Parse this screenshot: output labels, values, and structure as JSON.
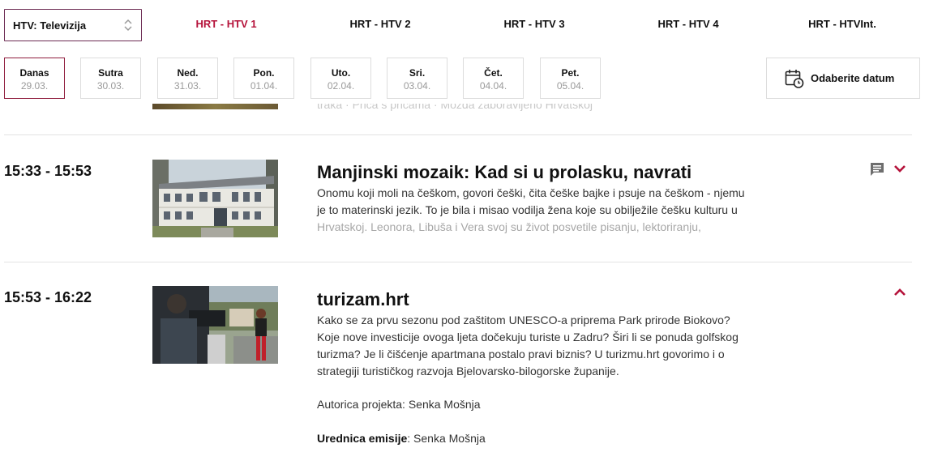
{
  "header": {
    "platform_select": "HTV: Televizija",
    "channels": [
      "HRT - HTV 1",
      "HRT - HTV 2",
      "HRT - HTV 3",
      "HRT - HTV 4",
      "HRT - HTVInt."
    ],
    "active_channel": "HRT - HTV 1",
    "accent_color": "#b5123a"
  },
  "days": [
    {
      "name": "Danas",
      "date": "29.03."
    },
    {
      "name": "Sutra",
      "date": "30.03."
    },
    {
      "name": "Ned.",
      "date": "31.03."
    },
    {
      "name": "Pon.",
      "date": "01.04."
    },
    {
      "name": "Uto.",
      "date": "02.04."
    },
    {
      "name": "Sri.",
      "date": "03.04."
    },
    {
      "name": "Čet.",
      "date": "04.04."
    },
    {
      "name": "Pet.",
      "date": "05.04."
    }
  ],
  "pick_date": {
    "label": "Odaberite datum",
    "icon": "calendar-clock-icon"
  },
  "previous_item_text": "traka · Priča s pričama · Možda zaboravljeno Hrvatskoj",
  "programs": [
    {
      "time": "15:33 - 15:53",
      "title": "Manjinski mozaik: Kad si u prolasku, navrati",
      "description_lines": [
        "Onomu koji moli na češkom, govori češki, čita češke bajke i psuje na češkom - njemu",
        "je to materinski jezik. To je bila i misao vodilja žena koje su obilježile češku kulturu u",
        "Hrvatskoj. Leonora, Libuša i Vera svoj su život posvetile pisanju, lektoriranju,"
      ],
      "expanded": false,
      "icons": [
        "comment-icon",
        "chevron-down-icon"
      ]
    },
    {
      "time": "15:53 - 16:22",
      "title": "turizam.hrt",
      "description_lines": [
        "Kako se za prvu sezonu pod zaštitom UNESCO-a priprema Park prirode Biokovo?",
        "Koje nove investicije ovoga ljeta dočekuju turiste u Zadru? Širi li se ponuda golfskog",
        "turizma? Je li čišćenje apartmana postalo pravi biznis? U turizmu.hrt govorimo i o",
        "strategiji turističkog razvoja Bjelovarsko-bilogorske županije."
      ],
      "author_line": "Autorica projekta: Senka Mošnja",
      "editor_label": "Urednica emisije",
      "editor_name": ": Senka Mošnja",
      "expanded": true,
      "icons": [
        "chevron-up-icon"
      ]
    }
  ]
}
